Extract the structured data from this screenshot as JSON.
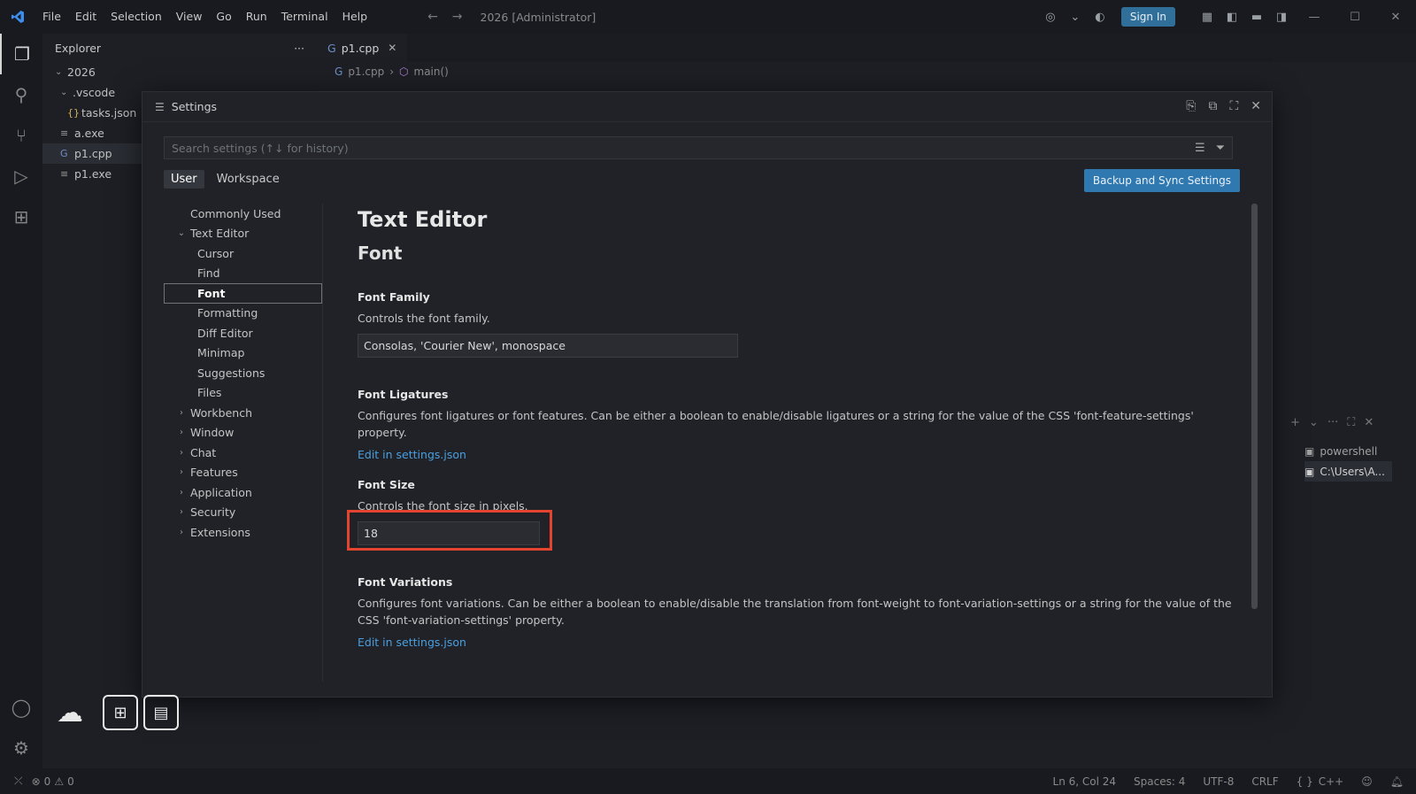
{
  "titlebar": {
    "menu": [
      "File",
      "Edit",
      "Selection",
      "View",
      "Go",
      "Run",
      "Terminal",
      "Help"
    ],
    "window_title": "2026 [Administrator]",
    "sign_in": "Sign In"
  },
  "explorer": {
    "title": "Explorer",
    "more": "···",
    "items": [
      {
        "label": "2026"
      },
      {
        "label": ".vscode"
      },
      {
        "label": "tasks.json"
      },
      {
        "label": "a.exe"
      },
      {
        "label": "p1.cpp"
      },
      {
        "label": "p1.exe"
      }
    ]
  },
  "editor": {
    "tab_label": "p1.cpp",
    "breadcrumb_file": "p1.cpp",
    "breadcrumb_symbol": "main()"
  },
  "terminal": {
    "items": [
      "powershell",
      "C:\\Users\\A..."
    ]
  },
  "statusbar": {
    "errors": "0",
    "warnings": "0",
    "position": "Ln 6, Col 24",
    "spaces": "Spaces: 4",
    "encoding": "UTF-8",
    "eol": "CRLF",
    "language": "C++"
  },
  "settings": {
    "title": "Settings",
    "search_placeholder": "Search settings (↑↓ for history)",
    "scope_user": "User",
    "scope_workspace": "Workspace",
    "backup_button": "Backup and Sync Settings",
    "toc": [
      {
        "label": "Commonly Used"
      },
      {
        "label": "Text Editor"
      },
      {
        "label": "Cursor"
      },
      {
        "label": "Find"
      },
      {
        "label": "Font"
      },
      {
        "label": "Formatting"
      },
      {
        "label": "Diff Editor"
      },
      {
        "label": "Minimap"
      },
      {
        "label": "Suggestions"
      },
      {
        "label": "Files"
      },
      {
        "label": "Workbench"
      },
      {
        "label": "Window"
      },
      {
        "label": "Chat"
      },
      {
        "label": "Features"
      },
      {
        "label": "Application"
      },
      {
        "label": "Security"
      },
      {
        "label": "Extensions"
      }
    ],
    "section_title": "Text Editor",
    "subsection_title": "Font",
    "font_family": {
      "title": "Font Family",
      "desc": "Controls the font family.",
      "value": "Consolas, 'Courier New', monospace"
    },
    "font_ligatures": {
      "title": "Font Ligatures",
      "desc": "Configures font ligatures or font features. Can be either a boolean to enable/disable ligatures or a string for the value of the CSS 'font-feature-settings' property.",
      "link": "Edit in settings.json"
    },
    "font_size": {
      "title": "Font Size",
      "desc": "Controls the font size in pixels.",
      "value": "18"
    },
    "font_variations": {
      "title": "Font Variations",
      "desc": "Configures font variations. Can be either a boolean to enable/disable the translation from font-weight to font-variation-settings or a string for the value of the CSS 'font-variation-settings' property.",
      "link": "Edit in settings.json"
    }
  },
  "colors": {
    "accent_button": "#2f78b0",
    "link": "#4a9fe0",
    "highlight_box": "#e24430"
  }
}
